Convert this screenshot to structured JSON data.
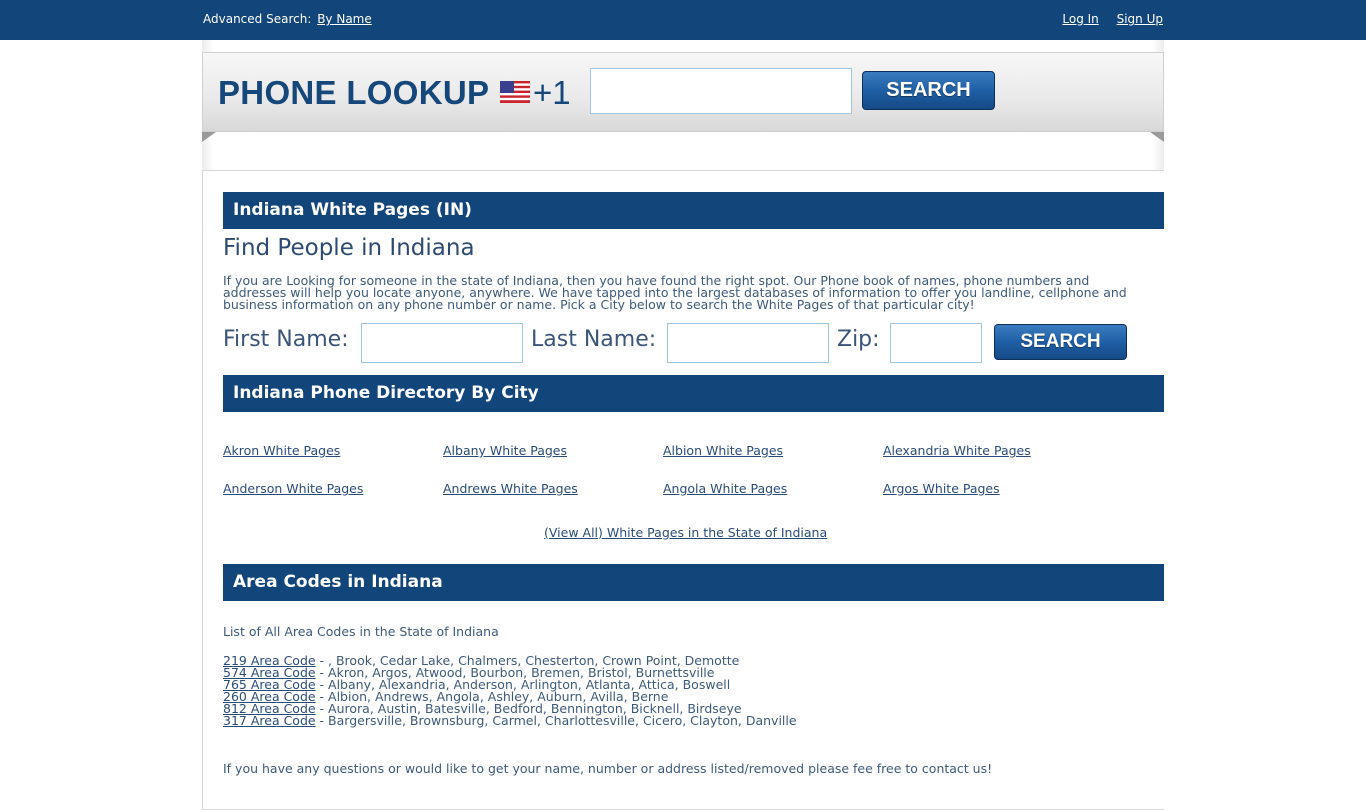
{
  "topbar": {
    "advanced_label": "Advanced Search:",
    "by_name_link": "By Name",
    "login": "Log In",
    "signup": "Sign Up"
  },
  "header": {
    "logo": "PHONE LOOKUP",
    "country_code": "+1",
    "flag_icon": "us-flag-icon",
    "phone_input_value": "",
    "phone_input_placeholder": "",
    "search_button": "SEARCH"
  },
  "section1": {
    "bar_title": "Indiana White Pages (IN)",
    "heading": "Find People in Indiana",
    "intro": "If you are Looking for someone in the state of Indiana, then you have found the right spot. Our Phone book of names, phone numbers and addresses will help you locate anyone, anywhere. We have tapped into the largest databases of information to offer you landline, cellphone and business information on any phone number or name. Pick a City below to search the White Pages of that particular city!",
    "first_name_label": "First Name:",
    "last_name_label": "Last Name:",
    "zip_label": "Zip:",
    "first_name_value": "",
    "last_name_value": "",
    "zip_value": "",
    "search_button": "SEARCH"
  },
  "section2": {
    "bar_title": "Indiana Phone Directory By City",
    "cities": [
      "Akron White Pages",
      "Albany White Pages",
      "Albion White Pages",
      "Alexandria White Pages",
      "Anderson White Pages",
      "Andrews White Pages",
      "Angola White Pages",
      "Argos White Pages"
    ],
    "view_all": "(View All) White Pages in the State of Indiana"
  },
  "section3": {
    "bar_title": "Area Codes in Indiana",
    "intro": "List of All Area Codes in the State of Indiana",
    "codes": [
      {
        "link": "219 Area Code",
        "cities": " - , Brook, Cedar Lake, Chalmers, Chesterton, Crown Point, Demotte"
      },
      {
        "link": "574 Area Code",
        "cities": " - Akron, Argos, Atwood, Bourbon, Bremen, Bristol, Burnettsville"
      },
      {
        "link": "765 Area Code",
        "cities": " - Albany, Alexandria, Anderson, Arlington, Atlanta, Attica, Boswell"
      },
      {
        "link": "260 Area Code",
        "cities": " - Albion, Andrews, Angola, Ashley, Auburn, Avilla, Berne"
      },
      {
        "link": "812 Area Code",
        "cities": " - Aurora, Austin, Batesville, Bedford, Bennington, Bicknell, Birdseye"
      },
      {
        "link": "317 Area Code",
        "cities": " - Bargersville, Brownsburg, Carmel, Charlottesville, Cicero, Clayton, Danville"
      }
    ],
    "contact": "If you have any questions or would like to get your name, number or address listed/removed please fee free to contact us!"
  }
}
